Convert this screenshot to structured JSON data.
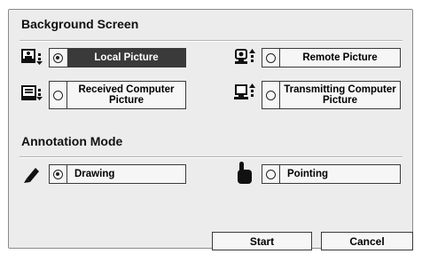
{
  "background_screen": {
    "title": "Background Screen",
    "options": [
      {
        "label": "Local Picture",
        "selected": true,
        "icon": "local-picture-icon"
      },
      {
        "label": "Remote Picture",
        "selected": false,
        "icon": "remote-camera-icon"
      },
      {
        "label": "Received Computer Picture",
        "selected": false,
        "icon": "received-computer-icon"
      },
      {
        "label": "Transmitting Computer Picture",
        "selected": false,
        "icon": "transmitting-computer-icon"
      }
    ]
  },
  "annotation_mode": {
    "title": "Annotation Mode",
    "options": [
      {
        "label": "Drawing",
        "selected": true,
        "icon": "pencil-icon"
      },
      {
        "label": "Pointing",
        "selected": false,
        "icon": "pointing-hand-icon"
      }
    ]
  },
  "buttons": {
    "start": "Start",
    "cancel": "Cancel"
  }
}
